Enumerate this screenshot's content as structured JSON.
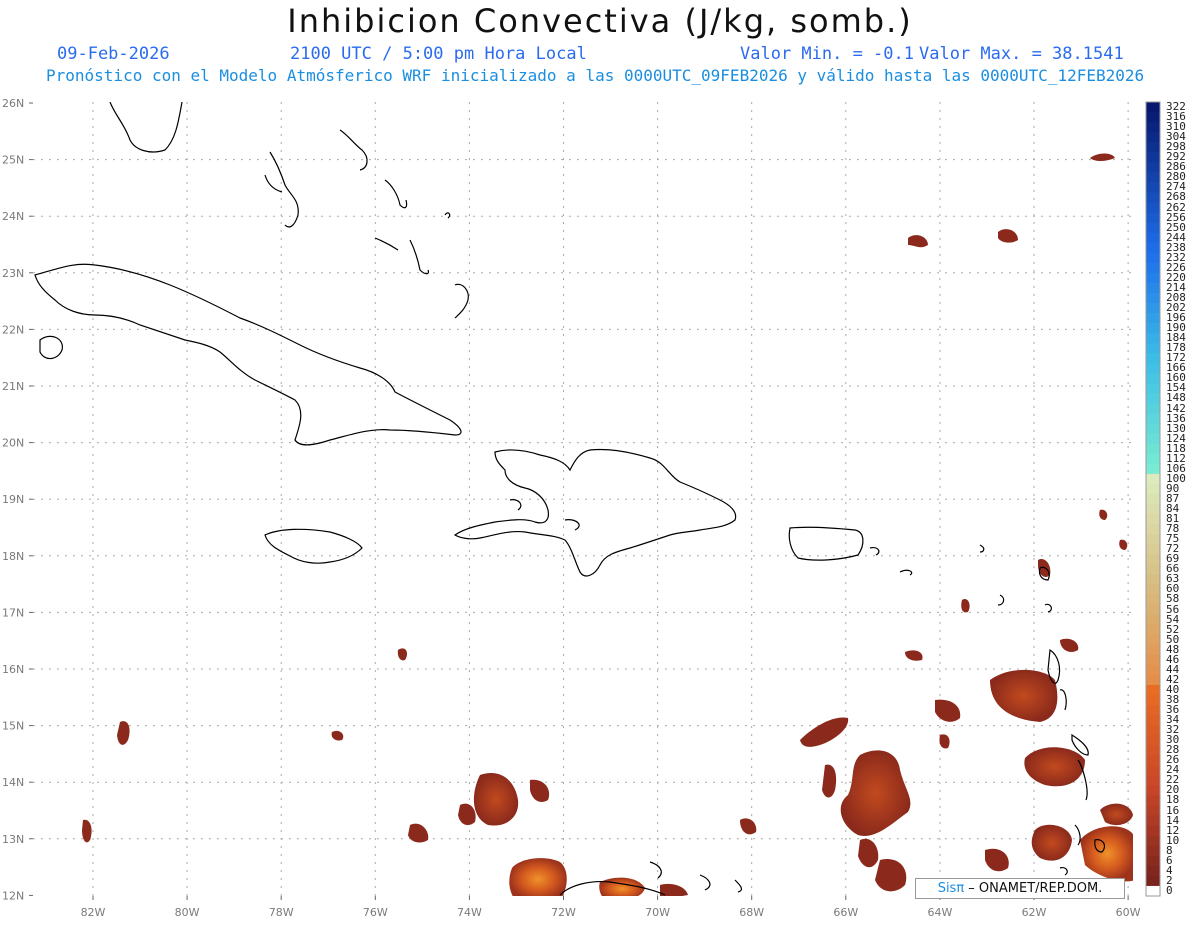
{
  "header": {
    "title": "Inhibicion Convectiva (J/kg, somb.)",
    "date": "09-Feb-2026",
    "time": "2100 UTC / 5:00 pm Hora Local",
    "min": "Valor Min. = -0.1",
    "max": "Valor Max. = 38.1541",
    "forecast": "Pronóstico con el Modelo Atmósferico WRF inicializado a las 0000UTC_09FEB2026 y válido hasta las  0000UTC_12FEB2026"
  },
  "axes": {
    "lat_labels": [
      "26N",
      "25N",
      "24N",
      "23N",
      "22N",
      "21N",
      "20N",
      "19N",
      "18N",
      "17N",
      "16N",
      "15N",
      "14N",
      "13N",
      "12N"
    ],
    "lon_labels": [
      "82W",
      "80W",
      "78W",
      "76W",
      "74W",
      "72W",
      "70W",
      "68W",
      "66W",
      "64W",
      "62W",
      "60W"
    ]
  },
  "colorbar": {
    "labels": [
      "322",
      "316",
      "310",
      "304",
      "298",
      "292",
      "286",
      "280",
      "274",
      "268",
      "262",
      "256",
      "250",
      "244",
      "238",
      "232",
      "226",
      "220",
      "214",
      "208",
      "202",
      "196",
      "190",
      "184",
      "178",
      "172",
      "166",
      "160",
      "154",
      "148",
      "142",
      "136",
      "130",
      "124",
      "118",
      "112",
      "106",
      "100",
      "90",
      "87",
      "84",
      "81",
      "78",
      "75",
      "72",
      "69",
      "66",
      "63",
      "60",
      "58",
      "56",
      "54",
      "52",
      "50",
      "48",
      "46",
      "44",
      "42",
      "40",
      "38",
      "36",
      "34",
      "32",
      "30",
      "28",
      "26",
      "24",
      "22",
      "20",
      "18",
      "16",
      "14",
      "12",
      "10",
      "8",
      "6",
      "4",
      "2",
      "0"
    ]
  },
  "credit": {
    "brand": "Sisπ",
    "text": " – ONAMET/REP.DOM."
  },
  "colors": {
    "title": "#111111",
    "header_blue": "#2a6bf0",
    "forecast_blue": "#1a8ee0",
    "field_dark": "#8b2a1c",
    "field_mid": "#c24a1e",
    "field_hot": "#e8721c"
  }
}
